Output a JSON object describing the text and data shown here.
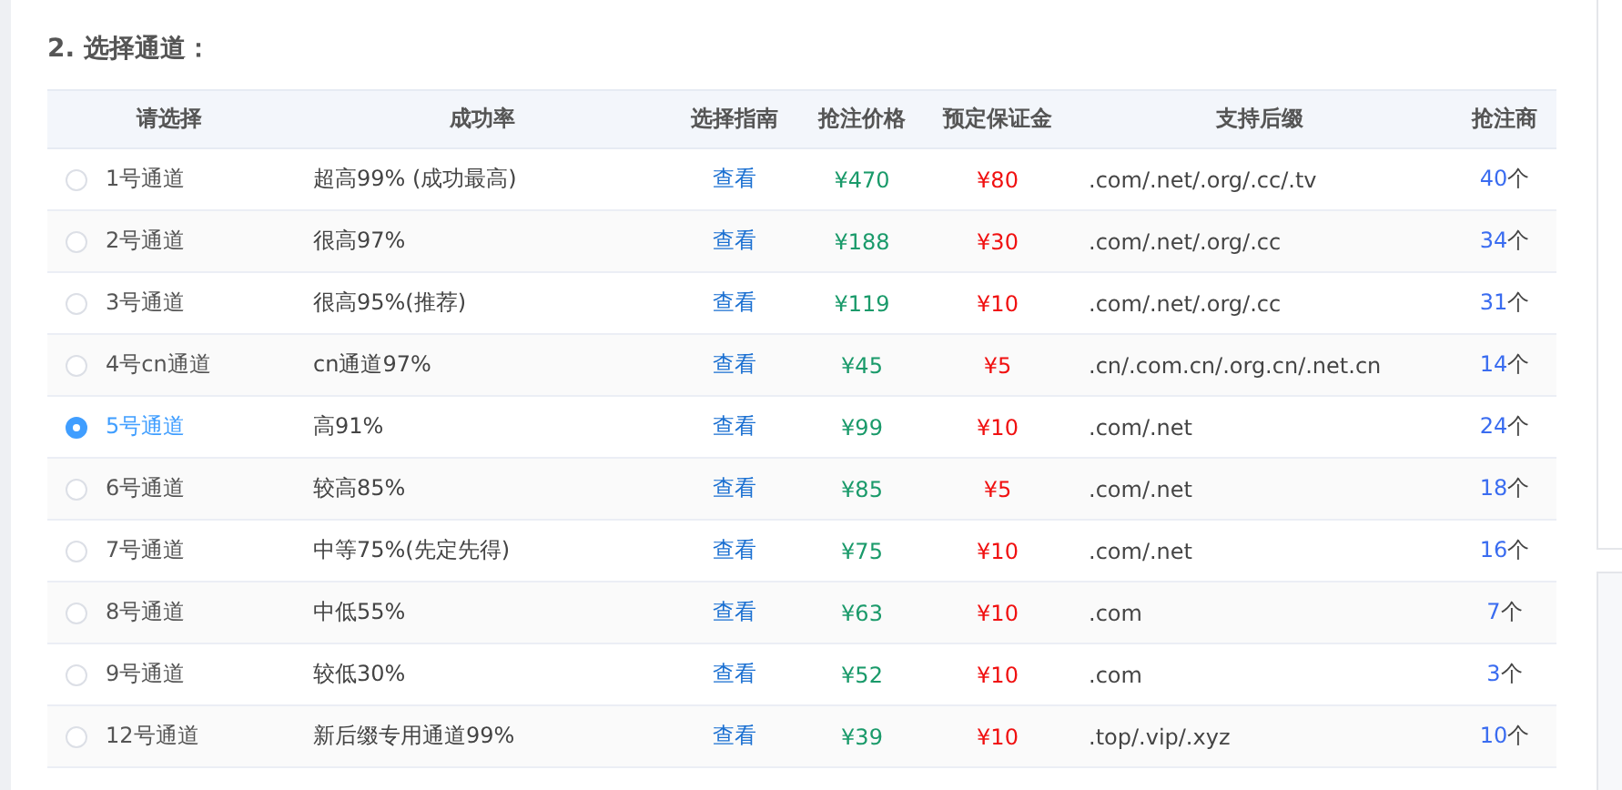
{
  "section_title": "2. 选择通道：",
  "table": {
    "columns": [
      "请选择",
      "成功率",
      "选择指南",
      "抢注价格",
      "预定保证金",
      "支持后缀",
      "抢注商"
    ],
    "rows": [
      {
        "selected": false,
        "channel": "1号通道",
        "rate": "超高99% (成功最高)",
        "guide": "查看",
        "price": "¥470",
        "deposit": "¥80",
        "suffixes": ".com/.net/.org/.cc/.tv",
        "count": "40",
        "unit": "个"
      },
      {
        "selected": false,
        "channel": "2号通道",
        "rate": "很高97%",
        "guide": "查看",
        "price": "¥188",
        "deposit": "¥30",
        "suffixes": ".com/.net/.org/.cc",
        "count": "34",
        "unit": "个"
      },
      {
        "selected": false,
        "channel": "3号通道",
        "rate": "很高95%(推荐)",
        "guide": "查看",
        "price": "¥119",
        "deposit": "¥10",
        "suffixes": ".com/.net/.org/.cc",
        "count": "31",
        "unit": "个"
      },
      {
        "selected": false,
        "channel": "4号cn通道",
        "rate": "cn通道97%",
        "guide": "查看",
        "price": "¥45",
        "deposit": "¥5",
        "suffixes": ".cn/.com.cn/.org.cn/.net.cn",
        "count": "14",
        "unit": "个"
      },
      {
        "selected": true,
        "channel": "5号通道",
        "rate": "高91%",
        "guide": "查看",
        "price": "¥99",
        "deposit": "¥10",
        "suffixes": ".com/.net",
        "count": "24",
        "unit": "个"
      },
      {
        "selected": false,
        "channel": "6号通道",
        "rate": "较高85%",
        "guide": "查看",
        "price": "¥85",
        "deposit": "¥5",
        "suffixes": ".com/.net",
        "count": "18",
        "unit": "个"
      },
      {
        "selected": false,
        "channel": "7号通道",
        "rate": "中等75%(先定先得)",
        "guide": "查看",
        "price": "¥75",
        "deposit": "¥10",
        "suffixes": ".com/.net",
        "count": "16",
        "unit": "个"
      },
      {
        "selected": false,
        "channel": "8号通道",
        "rate": "中低55%",
        "guide": "查看",
        "price": "¥63",
        "deposit": "¥10",
        "suffixes": ".com",
        "count": "7",
        "unit": "个"
      },
      {
        "selected": false,
        "channel": "9号通道",
        "rate": "较低30%",
        "guide": "查看",
        "price": "¥52",
        "deposit": "¥10",
        "suffixes": ".com",
        "count": "3",
        "unit": "个"
      },
      {
        "selected": false,
        "channel": "12号通道",
        "rate": "新后缀专用通道99%",
        "guide": "查看",
        "price": "¥39",
        "deposit": "¥10",
        "suffixes": ".top/.vip/.xyz",
        "count": "10",
        "unit": "个"
      }
    ]
  }
}
